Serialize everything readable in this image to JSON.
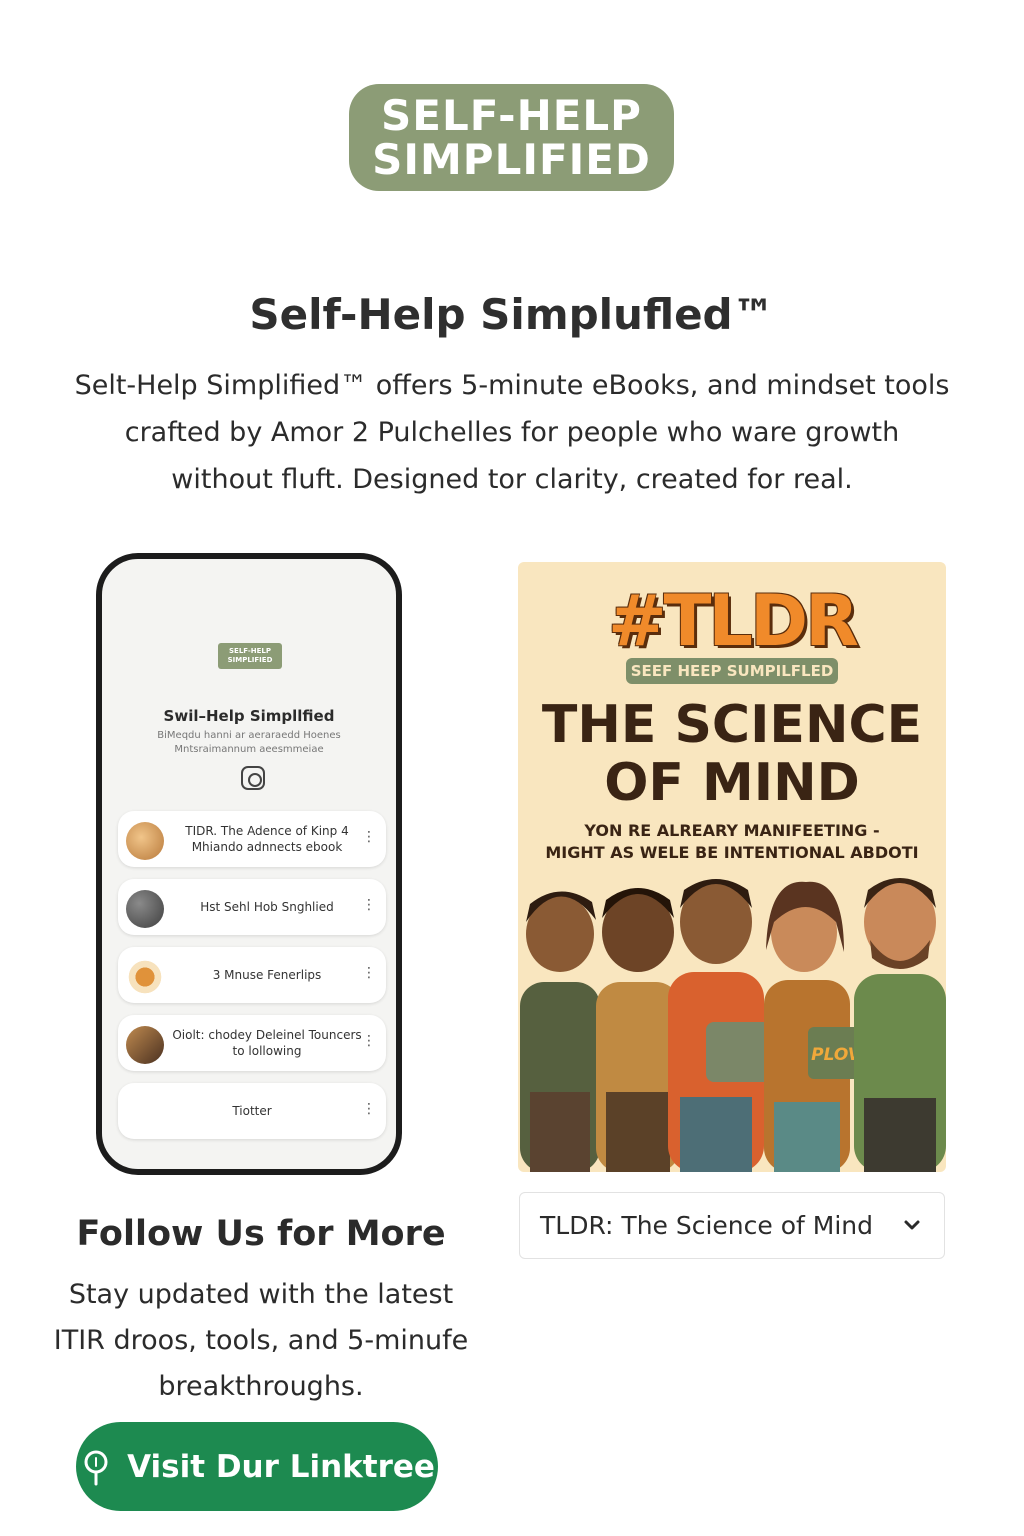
{
  "brand": {
    "logo_line1": "SELF-HELP",
    "logo_line2": "SIMPLIFIED",
    "accent_color": "#8c9c76"
  },
  "header": {
    "title": "Self-Help Simplufled™",
    "description": "Selt-Help Simplified™ offers 5-minute eBooks, and mindset tools crafted by Amor 2 Pulchelles for people who ware growth without fluft. Designed tor clarity, created for real."
  },
  "phone_preview": {
    "logo_text": "SELF-HELP SIMPLIFIED",
    "title": "Swil–Help Simpllfied",
    "description": "BiMeqdu hanni ar aeraraedd Hoenes Mntsraimannum aeesmmeiae",
    "social_icon": "instagram-icon",
    "links": [
      {
        "text": "TIDR. The Adence of Kinp 4 Mhiando adnnects ebook",
        "thumb": "#d8a15c"
      },
      {
        "text": "Hst Sehl Hob Snghlied",
        "thumb": "#5a5a5a"
      },
      {
        "text": "3 Mnuse Fenerlips",
        "thumb": "#e0923a"
      },
      {
        "text": "Oiolt: chodey Deleinel Touncers to lollowing",
        "thumb": "#8a5a2e"
      },
      {
        "text": "Tiotter",
        "thumb": null
      }
    ]
  },
  "follow": {
    "title": "Follow Us for More",
    "description": "Stay updated with the latest ITIR droos, tools, and 5-minufe breakthroughs.",
    "button_label": "Visit Dur Linktree",
    "button_icon": "linktree-icon",
    "button_color": "#1d8a50"
  },
  "book": {
    "tag": "#TLDR",
    "badge": "SEEF HEEP SUMPILFLED",
    "title_line1": "THE SCIENCE",
    "title_line2": "OF MIND",
    "subtitle_line1": "YON RE ALREARY MANIFEETING -",
    "subtitle_line2": "MIGHT AS WELE BE INTENTIONAL ABDOTI",
    "sign_text": "PLOVIE",
    "selected": "TLDR: The Science of Mind",
    "dropdown_icon": "chevron-down-icon"
  }
}
